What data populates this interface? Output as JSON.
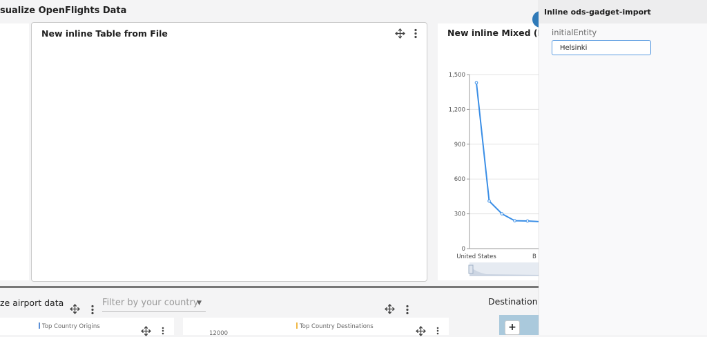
{
  "dashboard": {
    "title": "sualize OpenFlights Data"
  },
  "table_card": {
    "title": "New inline Table from File"
  },
  "chart_card": {
    "title": "New inline Mixed (ECI"
  },
  "chart_data": {
    "type": "line",
    "categories": [
      "United States",
      "",
      "",
      "",
      "",
      "",
      "B"
    ],
    "values": [
      1430,
      410,
      300,
      240,
      238,
      232,
      220
    ],
    "ylim": [
      0,
      1500
    ],
    "yticks": [
      0,
      300,
      600,
      900,
      1200,
      1500
    ],
    "yticks_labels": [
      "0",
      "300",
      "600",
      "900",
      "1,200",
      "1,500"
    ],
    "xtick_labels": [
      "United States",
      "B"
    ],
    "grid": true,
    "color": "#3a8ee6"
  },
  "bottom": {
    "airport_title": "ze airport data",
    "filter_placeholder": "Filter by your country",
    "origins_label": "Top Country Origins",
    "destinations_label": "Top Country Destinations",
    "destinations_value": "12000",
    "destination_title": "Destination a",
    "zoom_in": "+"
  },
  "panel": {
    "title": "Inline ods-gadget-import",
    "field_label": "initialEntity",
    "field_value": "Helsinki"
  },
  "colors": {
    "origins": "#5b8fd6",
    "destinations": "#f0b846",
    "accent": "#2f7ab8"
  }
}
